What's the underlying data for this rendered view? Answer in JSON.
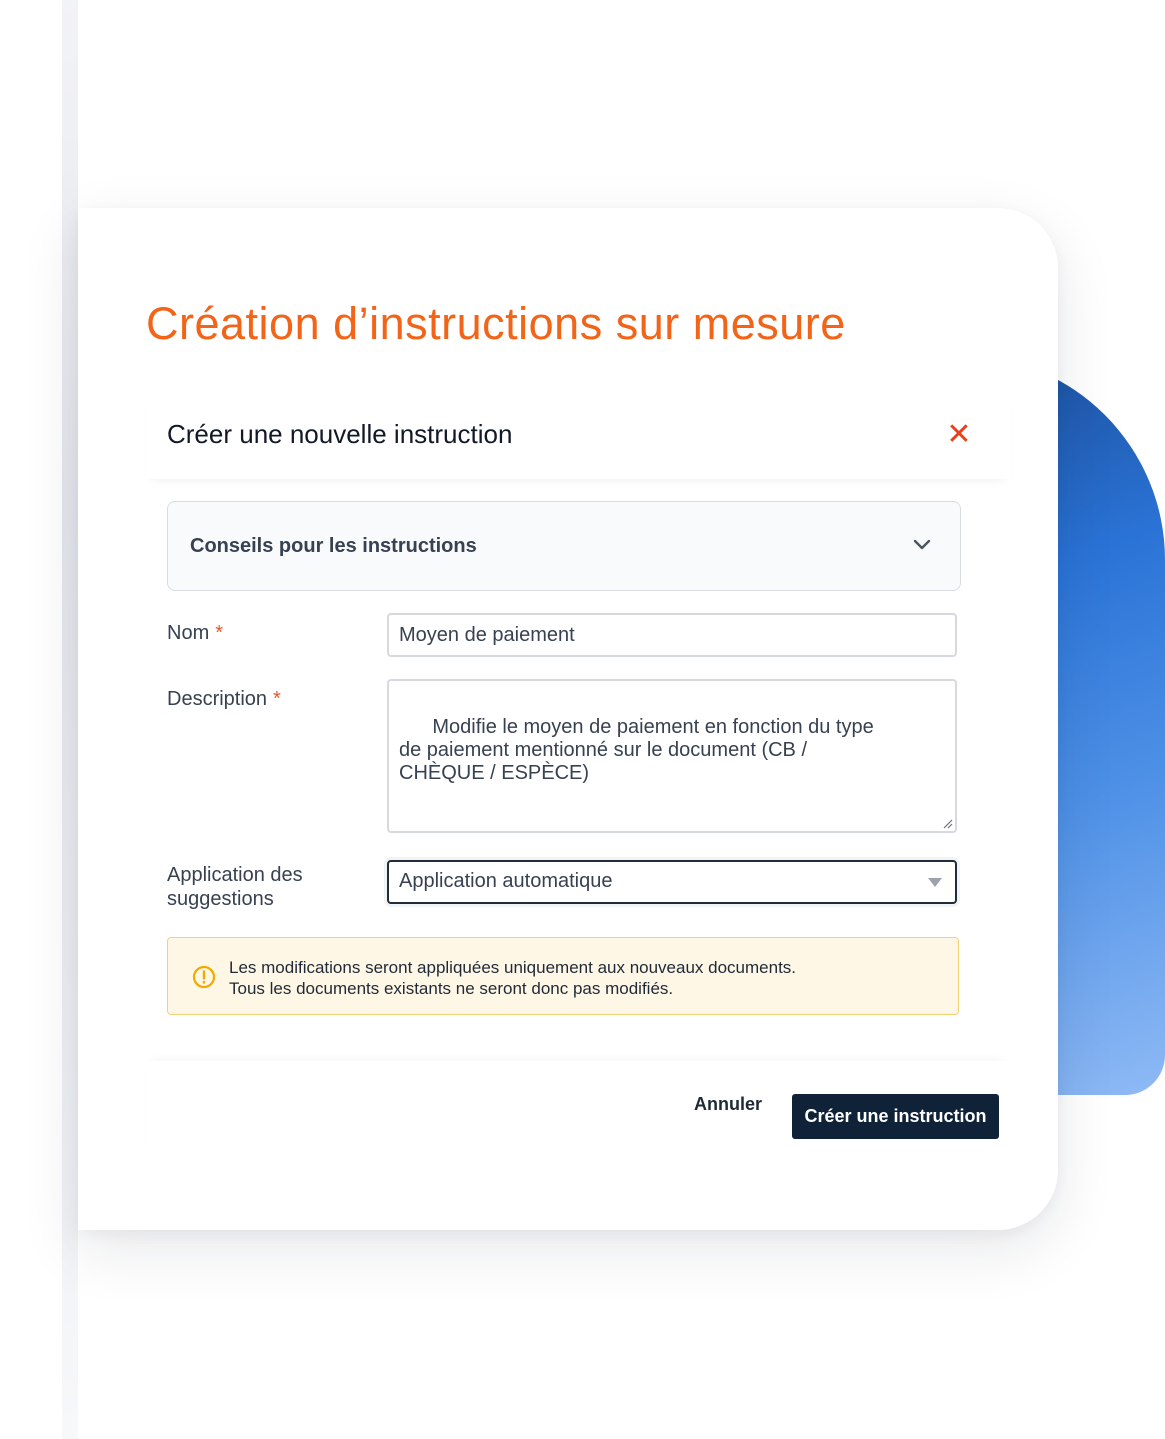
{
  "page": {
    "title": "Création d’instructions sur mesure"
  },
  "modal": {
    "title": "Créer une nouvelle instruction",
    "close_icon": "close-icon",
    "tips": {
      "label": "Conseils pour les instructions",
      "icon": "chevron-down-icon"
    },
    "fields": {
      "name": {
        "label": "Nom",
        "required_mark": "*",
        "value": "Moyen de paiement"
      },
      "description": {
        "label": "Description",
        "required_mark": "*",
        "value": "Modifie le moyen de paiement en fonction du type\nde paiement mentionné sur le document (CB /\nCHÈQUE / ESPÈCE)"
      },
      "suggestions": {
        "label_line1": "Application des",
        "label_line2": "suggestions",
        "selected": "Application automatique"
      }
    },
    "notice": {
      "icon": "warning-circle-icon",
      "line1": "Les modifications seront appliquées uniquement aux nouveaux documents.",
      "line2": "Tous les documents existants ne seront donc pas modifiés."
    },
    "footer": {
      "cancel_label": "Annuler",
      "create_label": "Créer une instruction"
    }
  },
  "colors": {
    "accent_title": "#f26418",
    "close": "#e8401c",
    "primary_button": "#0f2238",
    "notice_background": "#fff7e6",
    "notice_border": "#f5d27a",
    "notice_icon": "#f2a900",
    "decor_blue": "#2a73d6"
  }
}
